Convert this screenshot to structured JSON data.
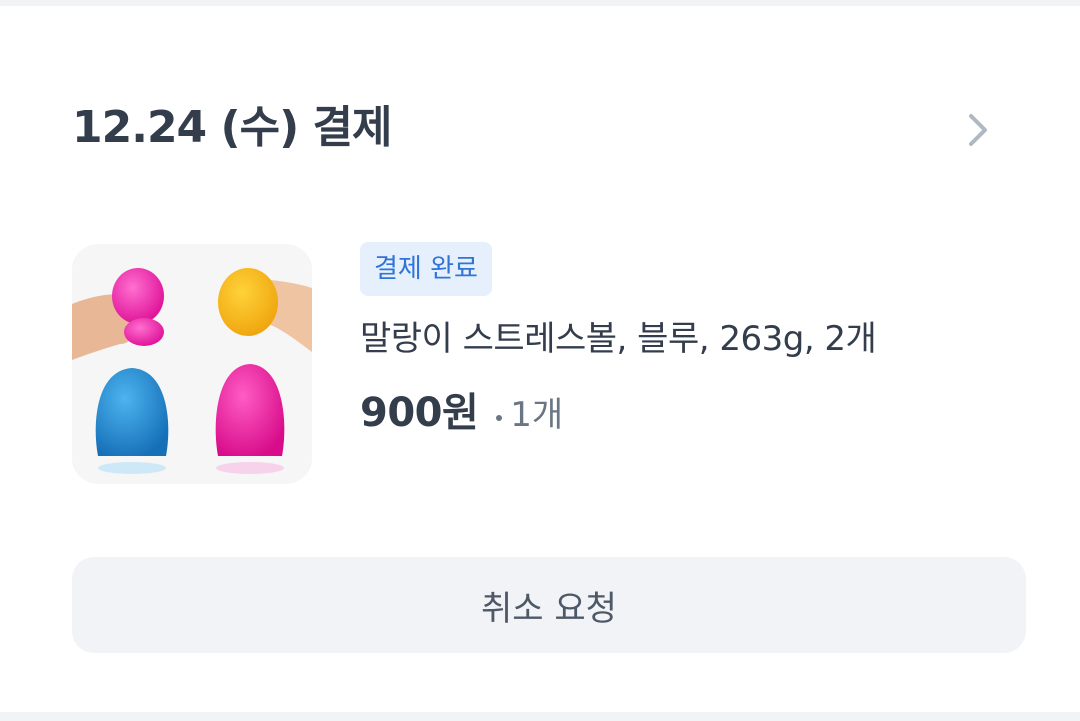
{
  "order": {
    "title": "12.24 (수) 결제",
    "detail_icon": "chevron-right-icon"
  },
  "item": {
    "status": "결제 완료",
    "name": "말랑이 스트레스볼, 블루, 263g, 2개",
    "price": "900원",
    "quantity": "1개",
    "thumbnail_description": "stress-ball-product-image"
  },
  "actions": {
    "cancel_label": "취소 요청"
  },
  "colors": {
    "text_primary": "#333d4b",
    "text_secondary": "#6b7684",
    "badge_bg": "#e6f0fd",
    "badge_text": "#2f74d6",
    "button_bg": "#f2f3f6",
    "chevron": "#b0b8c1"
  }
}
